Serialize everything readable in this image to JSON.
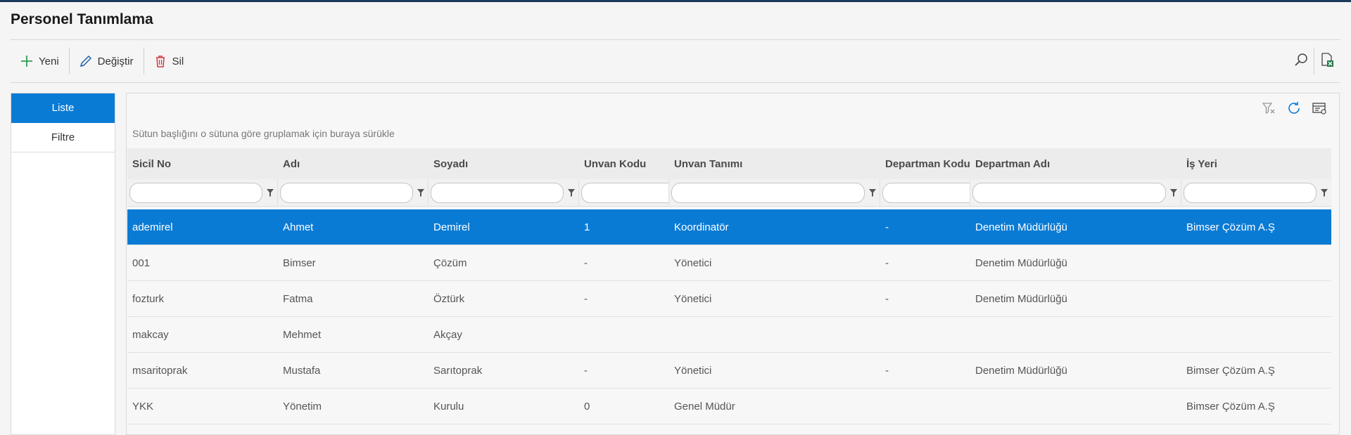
{
  "page": {
    "title": "Personel Tanımlama"
  },
  "toolbar": {
    "new_label": "Yeni",
    "edit_label": "Değiştir",
    "delete_label": "Sil"
  },
  "sidenav": {
    "items": [
      {
        "label": "Liste",
        "active": true
      },
      {
        "label": "Filtre",
        "active": false
      }
    ]
  },
  "grid": {
    "group_hint": "Sütun başlığını o sütuna göre gruplamak için buraya sürükle",
    "columns": [
      "Sicil No",
      "Adı",
      "Soyadı",
      "Unvan Kodu",
      "Unvan Tanımı",
      "Departman Kodu",
      "Departman Adı",
      "İş Yeri"
    ],
    "rows": [
      [
        "ademirel",
        "Ahmet",
        "Demirel",
        "1",
        "Koordinatör",
        "-",
        "Denetim Müdürlüğü",
        "Bimser Çözüm A.Ş"
      ],
      [
        "001",
        "Bimser",
        "Çözüm",
        "-",
        "Yönetici",
        "-",
        "Denetim Müdürlüğü",
        ""
      ],
      [
        "fozturk",
        "Fatma",
        "Öztürk",
        "-",
        "Yönetici",
        "-",
        "Denetim Müdürlüğü",
        ""
      ],
      [
        "makcay",
        "Mehmet",
        "Akçay",
        "",
        "",
        "",
        "",
        ""
      ],
      [
        "msaritoprak",
        "Mustafa",
        "Sarıtoprak",
        "-",
        "Yönetici",
        "-",
        "Denetim Müdürlüğü",
        "Bimser Çözüm A.Ş"
      ],
      [
        "YKK",
        "Yönetim",
        "Kurulu",
        "0",
        "Genel Müdür",
        "",
        "",
        "Bimser Çözüm A.Ş"
      ]
    ],
    "selected_row": 0
  },
  "colors": {
    "accent": "#0a7bd5",
    "add_icon": "#2e9e4f",
    "delete_icon": "#d9363e",
    "excel_icon": "#1e7b45"
  },
  "icons": [
    "plus-icon",
    "pencil-icon",
    "trash-icon",
    "search-icon",
    "excel-export-icon",
    "clear-filter-icon",
    "refresh-icon",
    "column-chooser-icon",
    "filter-icon"
  ]
}
